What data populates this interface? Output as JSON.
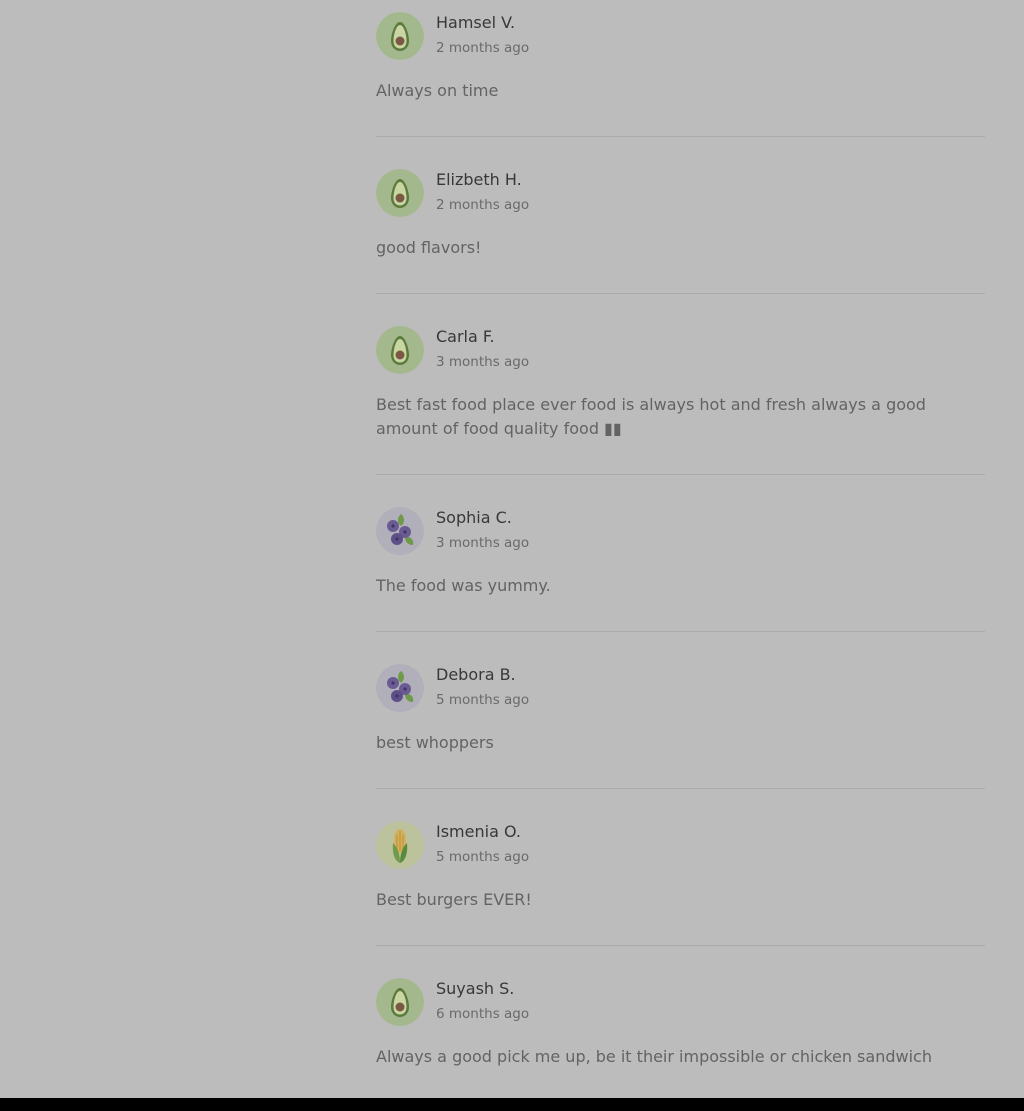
{
  "reviews": [
    {
      "name": "Hamsel V.",
      "time": "2 months ago",
      "text": "Always on time",
      "avatar": "avocado-icon"
    },
    {
      "name": "Elizbeth H.",
      "time": "2 months ago",
      "text": "good flavors!",
      "avatar": "avocado-icon"
    },
    {
      "name": "Carla F.",
      "time": "3 months ago",
      "text": "Best fast food place ever food is always hot and fresh always a good amount of food quality food ▮▮",
      "avatar": "avocado-icon"
    },
    {
      "name": "Sophia C.",
      "time": "3 months ago",
      "text": "The food was yummy.",
      "avatar": "blueberries-icon"
    },
    {
      "name": "Debora B.",
      "time": "5 months ago",
      "text": "best whoppers",
      "avatar": "blueberries-icon"
    },
    {
      "name": "Ismenia O.",
      "time": "5 months ago",
      "text": "Best burgers EVER!",
      "avatar": "corn-icon"
    },
    {
      "name": "Suyash S.",
      "time": "6 months ago",
      "text": "Always a good pick me up, be it their impossible or chicken sandwich",
      "avatar": "avocado-icon"
    }
  ],
  "colors": {
    "overlay_background": "#bcbcbc",
    "divider": "#aaaaaa",
    "avocado_bg": "#a4b88e",
    "blueberry_bg": "#b0afba",
    "corn_bg": "#bcc29c"
  }
}
